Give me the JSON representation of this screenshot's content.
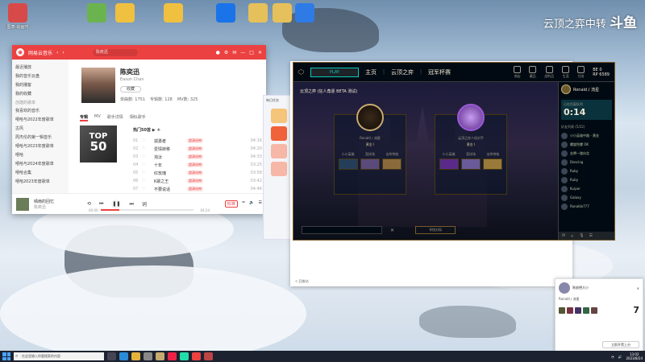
{
  "desktop": {
    "icons": [
      {
        "label": "图表-动画时",
        "color": "#d84a4a"
      },
      {
        "label": "",
        "color": "#6bb34f"
      },
      {
        "label": "",
        "color": "#f0c040"
      },
      {
        "label": "",
        "color": "#f0c040"
      },
      {
        "label": "",
        "color": "#1a73e8"
      },
      {
        "label": "",
        "color": "#e6c05a"
      },
      {
        "label": "",
        "color": "#e6c05a"
      },
      {
        "label": "",
        "color": "#2e7be6"
      }
    ],
    "brand_text": "云顶之弈中转",
    "brand_logo": "斗鱼"
  },
  "music": {
    "app_name": "网易云音乐",
    "search_placeholder": "陈奕迅",
    "sidebar": [
      {
        "label": "最近播放"
      },
      {
        "label": "我的音乐云盘"
      },
      {
        "label": "我的播客"
      },
      {
        "label": "我的收藏"
      }
    ],
    "sidebar_section": "创建的歌单",
    "playlists": [
      {
        "label": "我喜欢的音乐"
      },
      {
        "label": "嘻哈与2022年度歌单"
      },
      {
        "label": "古风"
      },
      {
        "label": "周杰伦的第一辑音乐"
      },
      {
        "label": "嘻哈与2023年度歌单"
      },
      {
        "label": "嘻哈"
      },
      {
        "label": "嘻哈与2024年度歌单"
      },
      {
        "label": "嘻哈合集"
      },
      {
        "label": "嘻哈2023年度歌单"
      }
    ],
    "artist": {
      "name": "陈奕迅",
      "en_name": "Eason Chan",
      "fav_label": "收藏",
      "stats": [
        "单曲数: 1751",
        "专辑数: 128",
        "MV数: 325"
      ]
    },
    "tabs": [
      "专辑",
      "MV",
      "歌手详情",
      "相似歌手"
    ],
    "cover_text": [
      "TOP",
      "50"
    ],
    "songs_header": "热门50首",
    "songs": [
      {
        "n": "01",
        "title": "孤勇者",
        "tag": "超清母带",
        "dur": "04:16"
      },
      {
        "n": "02",
        "title": "爱情转移",
        "tag": "超清母带",
        "dur": "04:20"
      },
      {
        "n": "03",
        "title": "淘汰",
        "tag": "超清母带",
        "dur": "04:33"
      },
      {
        "n": "04",
        "title": "十年",
        "tag": "超清母带",
        "dur": "03:25"
      },
      {
        "n": "05",
        "title": "红玫瑰",
        "tag": "超清母带",
        "dur": "03:58"
      },
      {
        "n": "06",
        "title": "K歌之王",
        "tag": "超清母带",
        "dur": "03:42"
      },
      {
        "n": "07",
        "title": "不要说话",
        "tag": "超清母带",
        "dur": "04:46"
      },
      {
        "n": "08",
        "title": "好久不见",
        "tag": "超清母带",
        "dur": "03:10"
      }
    ],
    "now_playing": {
      "title": "晴雨的回忆",
      "artist": "陈奕迅"
    },
    "time_left": "00:00",
    "time_right": "04:24",
    "progress": 0.2,
    "quality": "标准",
    "accent": "#ec4141"
  },
  "chatpanel": {
    "title": "每日任务"
  },
  "lol": {
    "play_label": "PLAY",
    "nav": [
      "主页",
      "云顶之弈",
      "冠军杯赛"
    ],
    "top_right": [
      "商店",
      "藏品",
      "战利品",
      "生涯",
      "任务"
    ],
    "currency": [
      "BE 0",
      "RP 6589"
    ],
    "mode_title": "云顶之弈 (狂人角逐 BETA 测试)",
    "cards": [
      {
        "name": "Ronald丿流星",
        "rank": "黄金 I",
        "slots": [
          "小小英雄",
          "竞技场",
          "击杀特效"
        ],
        "ring": "#c8aa6e"
      },
      {
        "name": "云顶之弈人机对手",
        "rank": "黄金 I",
        "slots": [
          "小小英雄",
          "竞技场",
          "击杀特效"
        ],
        "ring": "#9b59d6"
      }
    ],
    "find_label": "寻找对局",
    "social": {
      "me": "Ronald丿流星",
      "timer_label": "已在匹配队列",
      "timer": "0:14",
      "friends_header": "好友列表 (5/22)",
      "friends": [
        "小小英雄中路 - 黄金",
        "螺旋陀螺 OK",
        "金牌一路向北",
        "Dancing",
        "Ruby",
        "Ruby",
        "Kuiper",
        "Galaxy",
        "Ronaldo777"
      ]
    }
  },
  "sheet": {
    "footer": "< 回收站"
  },
  "notification": {
    "name": "陈俊德大小",
    "sub": "Ronald丿流星",
    "count": "7",
    "button": "立即开黑上分"
  },
  "taskbar": {
    "search_placeholder": "在这里输入你要搜索的内容",
    "time": "13:02",
    "date": "2023/8/24"
  }
}
